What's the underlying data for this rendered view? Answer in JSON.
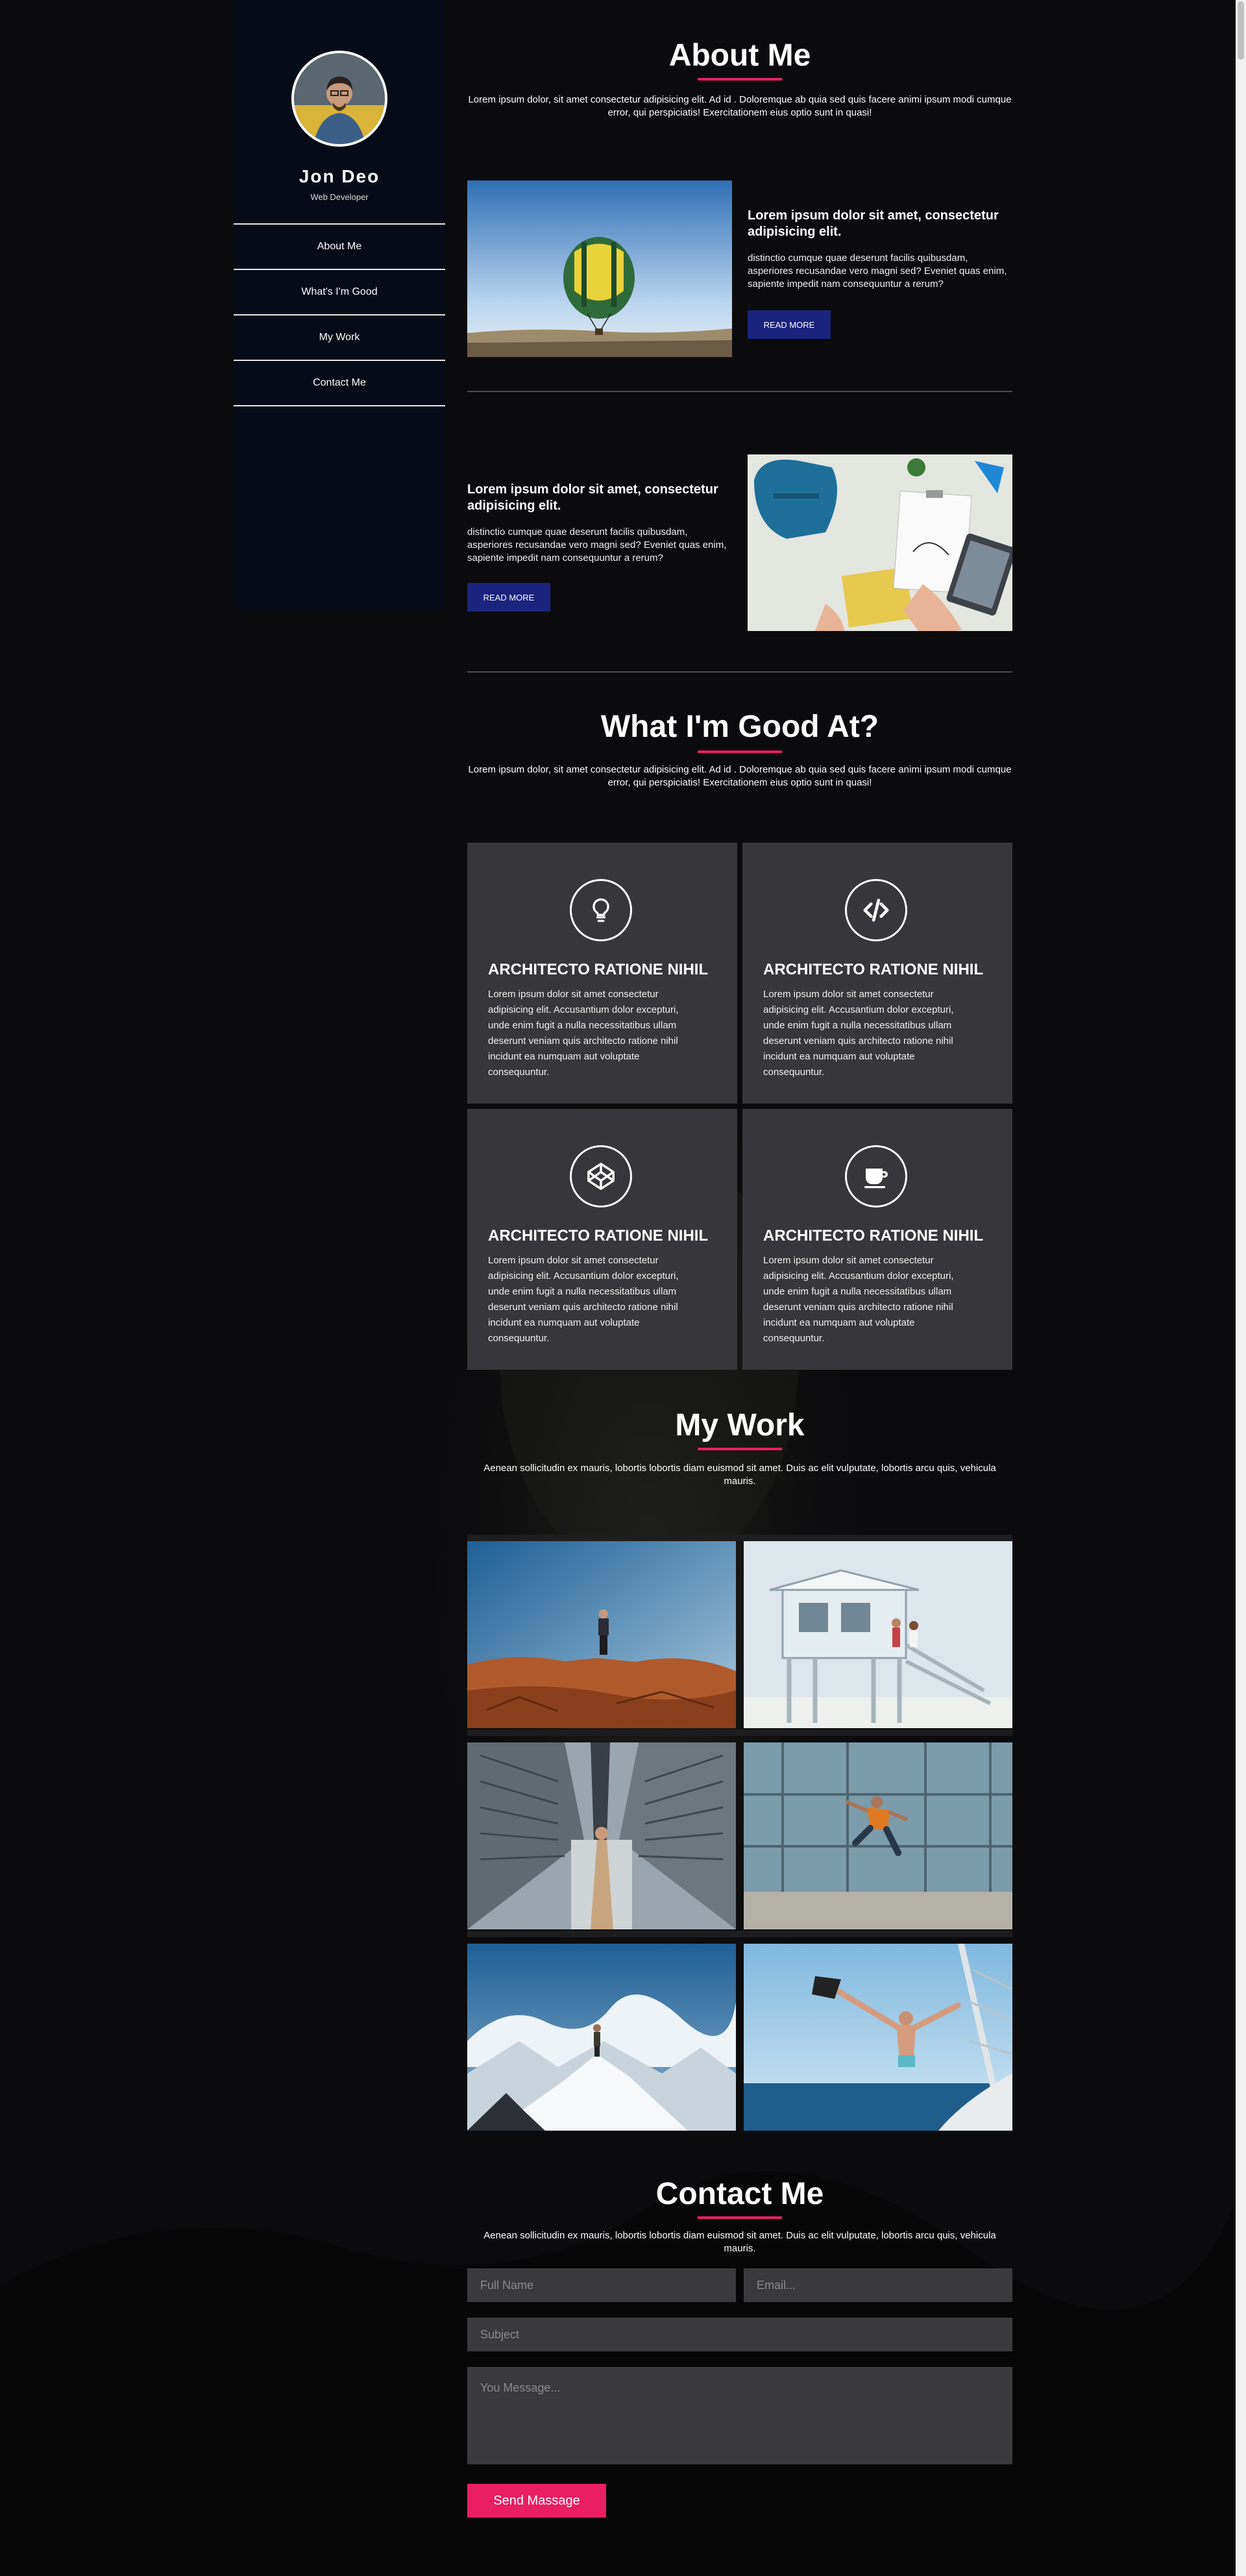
{
  "profile": {
    "name": "Jon Deo",
    "role": "Web Developer"
  },
  "nav": [
    "About Me",
    "What's I'm Good",
    "My Work",
    "Contact Me"
  ],
  "about": {
    "title": "About Me",
    "intro": "Lorem ipsum dolor, sit amet consectetur adipisicing elit. Ad id . Doloremque ab quia sed quis facere animi ipsum modi cumque error, qui perspiciatis! Exercitationem eius optio sunt in quasi!",
    "items": [
      {
        "heading": "Lorem ipsum dolor sit amet, consectetur adipisicing elit.",
        "text": "distinctio cumque quae deserunt facilis quibusdam, asperiores recusandae vero magni sed? Eveniet quas enim, sapiente impedit nam consequuntur a rerum?",
        "button": "READ MORE"
      },
      {
        "heading": "Lorem ipsum dolor sit amet, consectetur adipisicing elit.",
        "text": "distinctio cumque quae deserunt facilis quibusdam, asperiores recusandae vero magni sed? Eveniet quas enim, sapiente impedit nam consequuntur a rerum?",
        "button": "READ MORE"
      }
    ]
  },
  "skills": {
    "title": "What I'm Good At?",
    "intro": "Lorem ipsum dolor, sit amet consectetur adipisicing elit. Ad id . Doloremque ab quia sed quis facere animi ipsum modi cumque error, qui perspiciatis! Exercitationem eius optio sunt in quasi!",
    "cards": [
      {
        "icon": "lightbulb-icon",
        "title": "ARCHITECTO RATIONE NIHIL",
        "text": "Lorem ipsum dolor sit amet consectetur adipisicing elit. Accusantium dolor excepturi, unde enim fugit a nulla necessitatibus ullam deserunt veniam quis architecto ratione nihil incidunt ea numquam aut voluptate consequuntur."
      },
      {
        "icon": "code-icon",
        "title": "ARCHITECTO RATIONE NIHIL",
        "text": "Lorem ipsum dolor sit amet consectetur adipisicing elit. Accusantium dolor excepturi, unde enim fugit a nulla necessitatibus ullam deserunt veniam quis architecto ratione nihil incidunt ea numquam aut voluptate consequuntur."
      },
      {
        "icon": "codepen-icon",
        "title": "ARCHITECTO RATIONE NIHIL",
        "text": "Lorem ipsum dolor sit amet consectetur adipisicing elit. Accusantium dolor excepturi, unde enim fugit a nulla necessitatibus ullam deserunt veniam quis architecto ratione nihil incidunt ea numquam aut voluptate consequuntur."
      },
      {
        "icon": "coffee-cup-icon",
        "title": "ARCHITECTO RATIONE NIHIL",
        "text": "Lorem ipsum dolor sit amet consectetur adipisicing elit. Accusantium dolor excepturi, unde enim fugit a nulla necessitatibus ullam deserunt veniam quis architecto ratione nihil incidunt ea numquam aut voluptate consequuntur."
      }
    ]
  },
  "work": {
    "title": "My Work",
    "intro": "Aenean sollicitudin ex mauris, lobortis lobortis diam euismod sit amet. Duis ac elit vulputate, lobortis arcu quis, vehicula mauris."
  },
  "contact": {
    "title": "Contact Me",
    "intro": "Aenean sollicitudin ex mauris, lobortis lobortis diam euismod sit amet. Duis ac elit vulputate, lobortis arcu quis, vehicula mauris.",
    "placeholders": {
      "name": "Full Name",
      "email": "Email...",
      "subject": "Subject",
      "message": "You Message..."
    },
    "button": "Send Massage"
  },
  "colors": {
    "accent": "#e91e63",
    "button": "#1a237e",
    "sidebar": "#070a18",
    "card": "#37373b"
  }
}
